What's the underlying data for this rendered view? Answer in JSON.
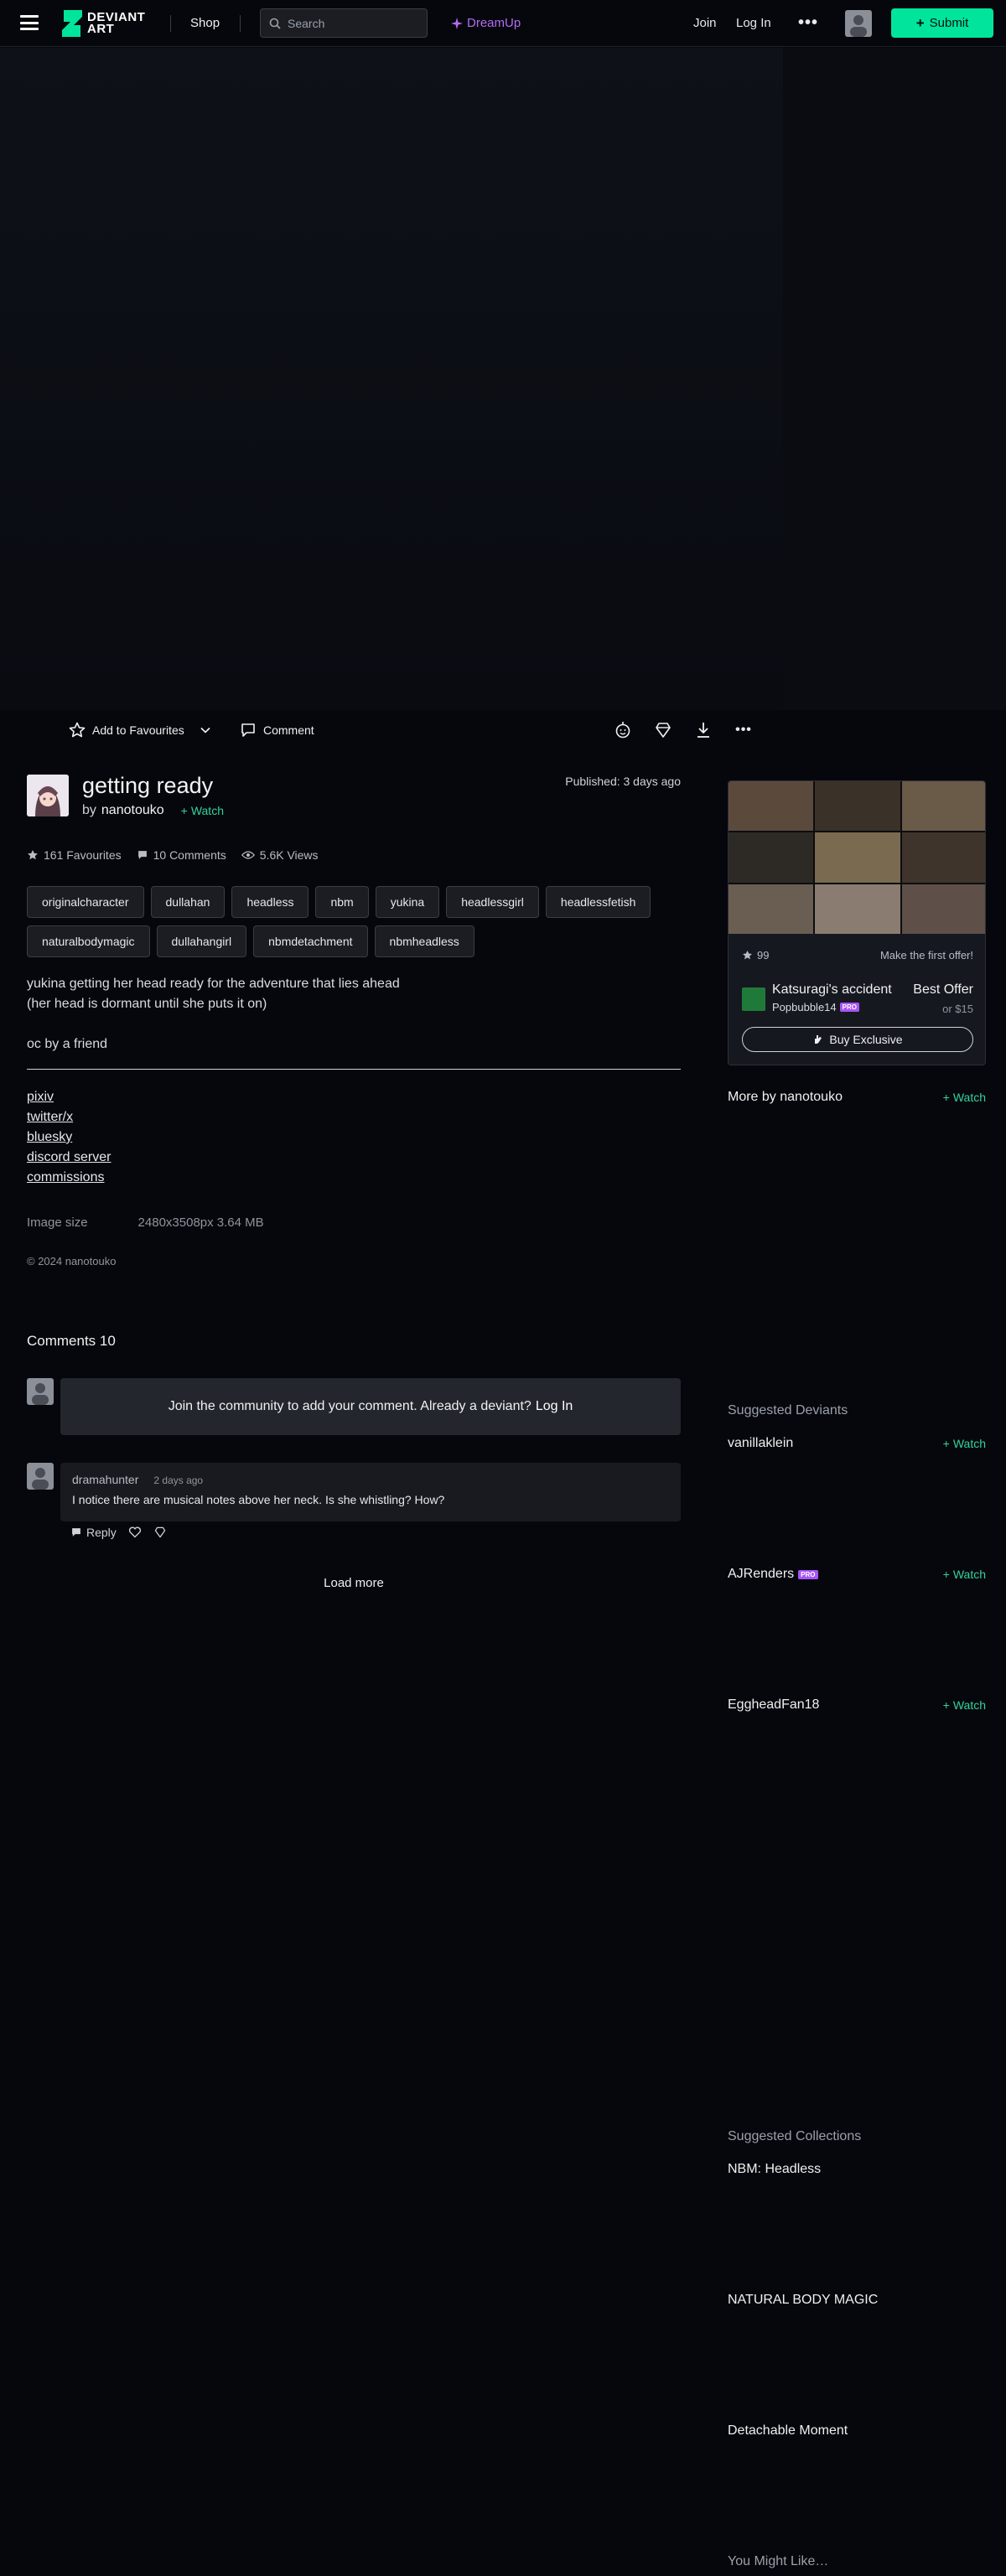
{
  "header": {
    "shop": "Shop",
    "search_placeholder": "Search",
    "dreamup": "DreamUp",
    "join": "Join",
    "login": "Log In",
    "submit": "Submit",
    "logo_line1": "DEVIANT",
    "logo_line2": "ART"
  },
  "actions": {
    "add_favourites": "Add to Favourites",
    "comment": "Comment"
  },
  "deviation": {
    "title": "getting ready",
    "by": "by",
    "author": "nanotouko",
    "watch": "Watch",
    "published": "Published: 3 days ago",
    "stats": {
      "favourites": "161 Favourites",
      "comments": "10 Comments",
      "views": "5.6K Views"
    },
    "tags": [
      "originalcharacter",
      "dullahan",
      "headless",
      "nbm",
      "yukina",
      "headlessgirl",
      "headlessfetish",
      "naturalbodymagic",
      "dullahangirl",
      "nbmdetachment",
      "nbmheadless"
    ],
    "description": [
      "yukina getting her head ready for the adventure that lies ahead",
      "(her head is dormant until she puts it on)",
      "",
      "oc by a friend"
    ],
    "links": [
      "pixiv",
      "twitter/x",
      "bluesky",
      "discord server",
      "commissions"
    ],
    "image_size_label": "Image size",
    "image_size_value": "2480x3508px 3.64 MB",
    "copyright": "© 2024 nanotouko"
  },
  "comments": {
    "heading": "Comments 10",
    "join_text": "Join the community to add your comment. Already a deviant?",
    "join_login": "Log In",
    "items": [
      {
        "user": "dramahunter",
        "time": "2 days ago",
        "text": "I notice there are musical notes above her neck. Is she whistling? How?"
      }
    ],
    "reply": "Reply",
    "load_more": "Load more"
  },
  "sidebar": {
    "card": {
      "favs": "99",
      "offer_prompt": "Make the first offer!",
      "name": "Katsuragi's accident",
      "seller": "Popbubble14",
      "seller_badge": "PRO",
      "best_offer": "Best Offer",
      "or_price": "or $15",
      "buy": "Buy Exclusive"
    },
    "more_by": "More by nanotouko",
    "watch": "Watch",
    "suggested_deviants": "Suggested Deviants",
    "deviants": [
      {
        "name": "vanillaklein",
        "badge": ""
      },
      {
        "name": "AJRenders",
        "badge": "PRO"
      },
      {
        "name": "EggheadFan18",
        "badge": ""
      }
    ],
    "suggested_collections": "Suggested Collections",
    "collections": [
      "NBM: Headless",
      "NATURAL BODY MAGIC",
      "Detachable Moment"
    ],
    "you_might_like": "You Might Like…"
  },
  "colors": {
    "accent_green": "#00e59b",
    "watch_green": "#34d399",
    "dreamup_purple": "#b26df0",
    "background": "#06070d"
  }
}
